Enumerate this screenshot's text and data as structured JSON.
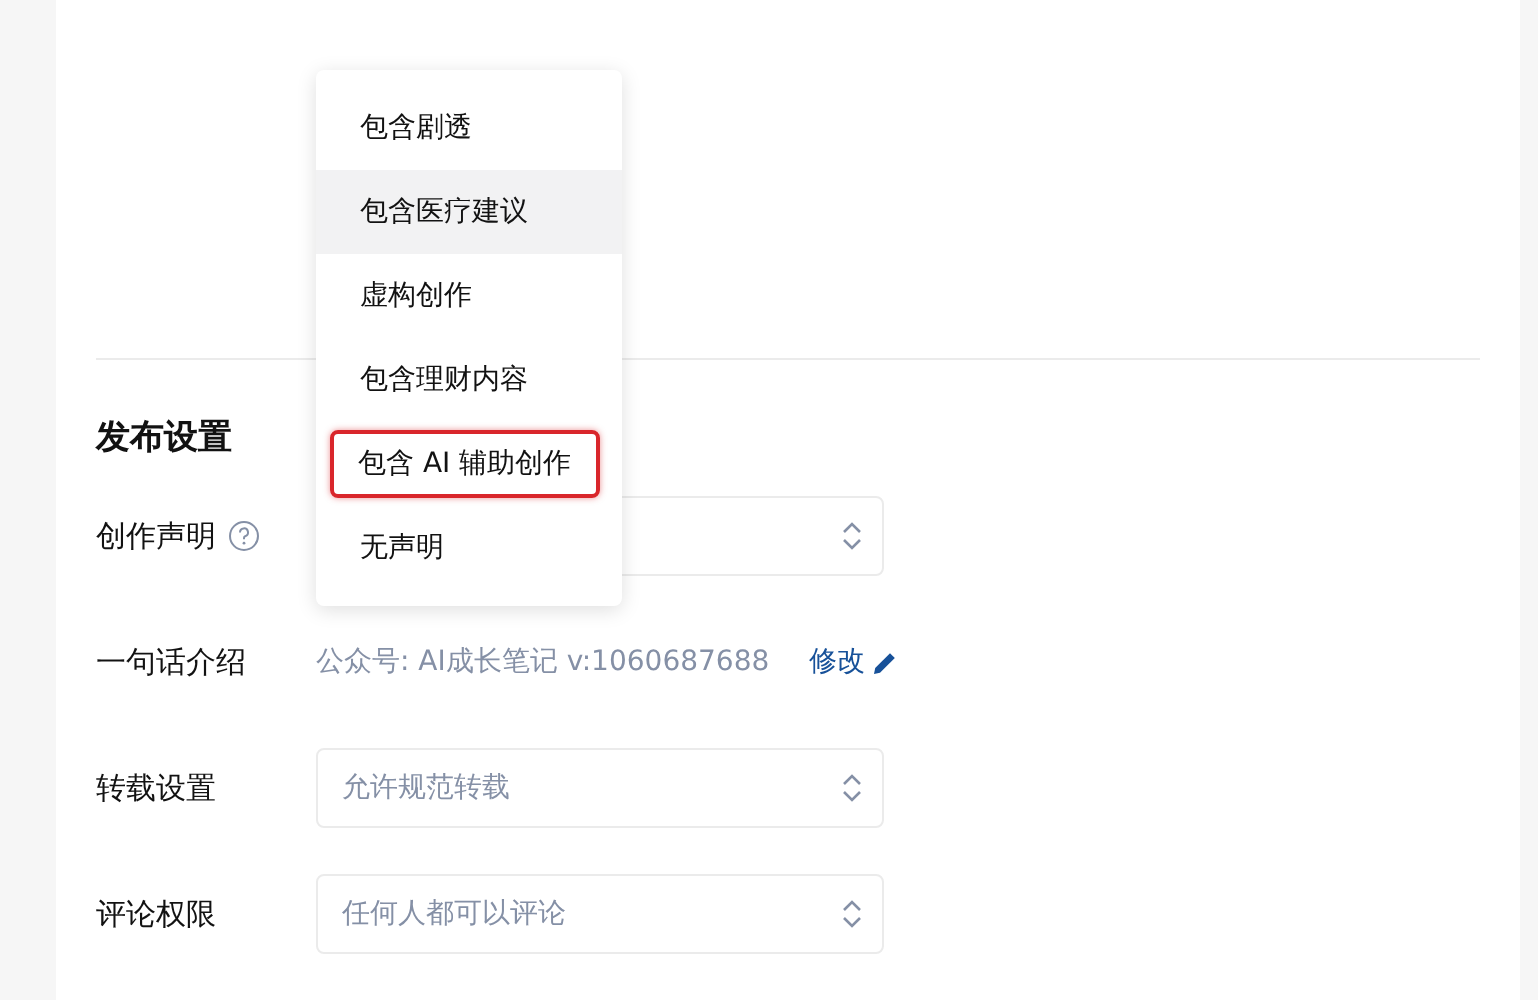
{
  "declaration_menu": {
    "items": [
      {
        "label": "包含剧透",
        "hovered": false,
        "outlined": false
      },
      {
        "label": "包含医疗建议",
        "hovered": true,
        "outlined": false
      },
      {
        "label": "虚构创作",
        "hovered": false,
        "outlined": false
      },
      {
        "label": "包含理财内容",
        "hovered": false,
        "outlined": false
      },
      {
        "label": "包含 AI 辅助创作",
        "hovered": false,
        "outlined": true
      },
      {
        "label": "无声明",
        "hovered": false,
        "outlined": false
      }
    ]
  },
  "section": {
    "title": "发布设置"
  },
  "fields": [
    {
      "kind": "select",
      "label": "创作声明",
      "help": true
    },
    {
      "kind": "text",
      "label": "一句话介绍",
      "value": "公众号: AI成长笔记 v:1060687688",
      "action": "修改"
    },
    {
      "kind": "select",
      "label": "转载设置",
      "value": "允许规范转载"
    },
    {
      "kind": "select",
      "label": "评论权限",
      "value": "任何人都可以评论"
    }
  ]
}
